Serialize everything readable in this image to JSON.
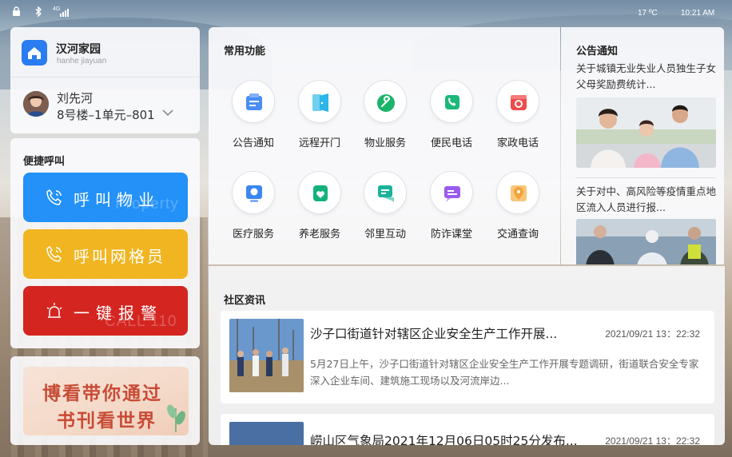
{
  "status_bar": {
    "icons": [
      "lock-icon",
      "bluetooth-icon",
      "signal-4g-icon"
    ],
    "network_label": "4G",
    "temperature": "17 ºC",
    "time": "10:21 AM"
  },
  "home": {
    "icon": "home-icon",
    "name": "汉河家园",
    "subtitle": "hanhe jiayuan",
    "user_name": "刘先河",
    "address": "8号楼–1单元–801",
    "dropdown_icon": "chevron-down-icon"
  },
  "quick_call": {
    "title": "便捷呼叫",
    "buttons": [
      {
        "label": "呼叫物业",
        "icon": "phone-icon",
        "color": "#2391f7",
        "ghost_text": "Property"
      },
      {
        "label": "呼叫网格员",
        "icon": "phone-icon",
        "color": "#f0b521",
        "ghost_text": ""
      },
      {
        "label": "一键报警",
        "icon": "alarm-icon",
        "color": "#d42520",
        "ghost_text": "CALL 110"
      }
    ]
  },
  "banner": {
    "line1": "博看带你通过",
    "line2": "书刊看世界"
  },
  "functions": {
    "title": "常用功能",
    "items": [
      {
        "label": "公告通知",
        "icon": "notice-icon",
        "color": "#4a8ef5"
      },
      {
        "label": "远程开门",
        "icon": "door-icon",
        "color": "#2cb5e8"
      },
      {
        "label": "物业服务",
        "icon": "wrench-icon",
        "color": "#19b46a"
      },
      {
        "label": "便民电话",
        "icon": "phone-icon",
        "color": "#1bb87a"
      },
      {
        "label": "家政电话",
        "icon": "housekeeping-icon",
        "color": "#ef4b4b"
      },
      {
        "label": "医疗服务",
        "icon": "medical-icon",
        "color": "#3b86f0"
      },
      {
        "label": "养老服务",
        "icon": "heart-icon",
        "color": "#14b27a"
      },
      {
        "label": "邻里互动",
        "icon": "chat-icon",
        "color": "#1ab39a"
      },
      {
        "label": "防诈课堂",
        "icon": "classroom-icon",
        "color": "#9a5cf0"
      },
      {
        "label": "交通查询",
        "icon": "map-pin-icon",
        "color": "#f3a33a"
      }
    ]
  },
  "notices": {
    "title": "公告通知",
    "items": [
      {
        "text": "关于城镇无业失业人员独生子女父母奖励费统计..."
      },
      {
        "text": "关于对中、高风险等疫情重点地区流入人员进行报..."
      }
    ]
  },
  "news": {
    "title": "社区资讯",
    "items": [
      {
        "title": "沙子口街道针对辖区企业安全生产工作开展...",
        "date": "2021/09/21  13：22:32",
        "desc": "5月27日上午，沙子口街道针对辖区企业安全生产工作开展专题调研，街道联合安全专家深入企业车间、建筑施工现场以及河流岸边..."
      },
      {
        "title": "崂山区气象局2021年12月06日05时25分发布...",
        "date": "2021/09/21  13：22:32",
        "desc": ""
      }
    ]
  }
}
